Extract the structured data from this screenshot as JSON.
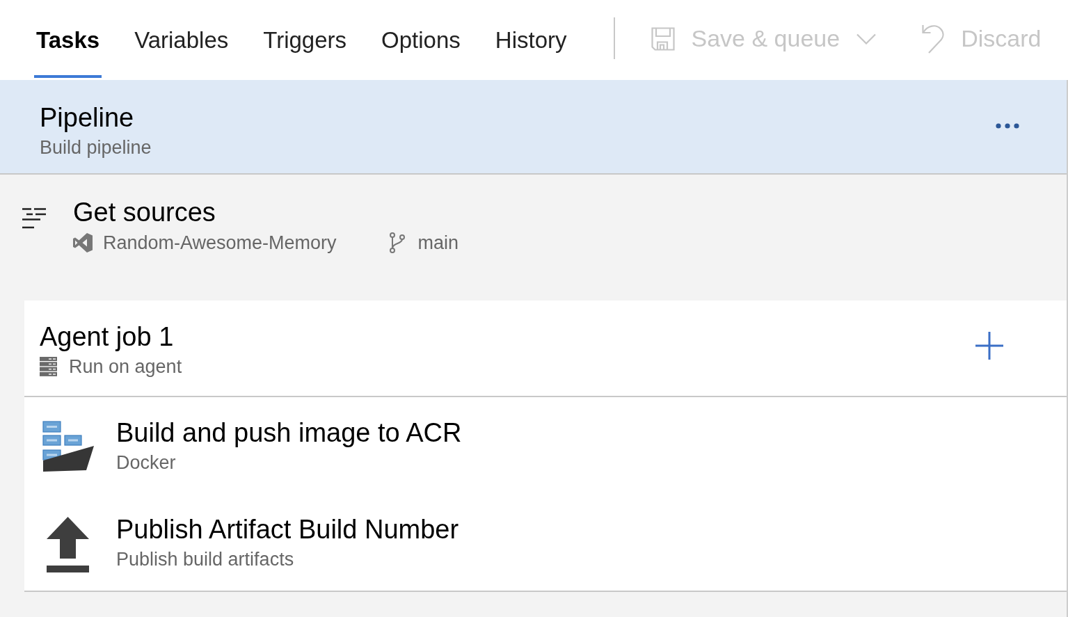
{
  "tabs": [
    {
      "label": "Tasks",
      "selected": true
    },
    {
      "label": "Variables",
      "selected": false
    },
    {
      "label": "Triggers",
      "selected": false
    },
    {
      "label": "Options",
      "selected": false
    },
    {
      "label": "History",
      "selected": false
    }
  ],
  "toolbar": [
    {
      "kind": "save",
      "label": "Save & queue",
      "dropdown": true,
      "disabled": true
    },
    {
      "kind": "discard",
      "label": "Discard",
      "disabled": true
    }
  ],
  "pipeline": {
    "title": "Pipeline",
    "subtitle": "Build pipeline",
    "selected": true
  },
  "get_sources": {
    "title": "Get sources",
    "repository": "Random-Awesome-Memory",
    "branch": "main",
    "selected": false
  },
  "job": {
    "title": "Agent job 1",
    "subtitle": "Run on agent",
    "selected": false,
    "tasks": [
      {
        "kind": "docker",
        "title": "Build and push image to ACR",
        "subtitle": "Docker",
        "selected": false
      },
      {
        "kind": "publish",
        "title": "Publish Artifact Build Number",
        "subtitle": "Publish build artifacts",
        "selected": false
      }
    ]
  }
}
